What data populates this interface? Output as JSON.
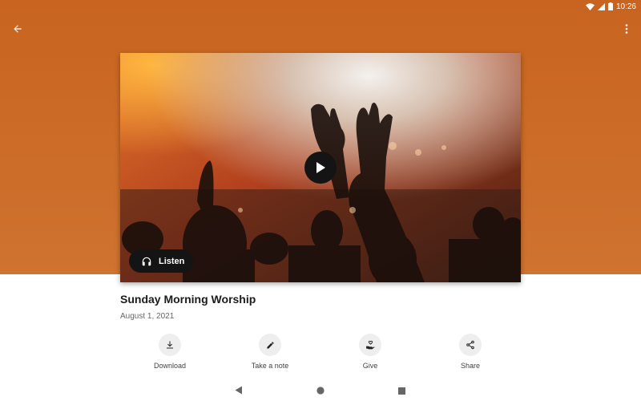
{
  "status_bar": {
    "time": "10:26"
  },
  "media": {
    "listen_label": "Listen"
  },
  "sermon": {
    "title": "Sunday Morning Worship",
    "date": "August 1, 2021"
  },
  "actions": [
    {
      "label": "Download",
      "icon": "download-icon"
    },
    {
      "label": "Take a note",
      "icon": "pencil-icon"
    },
    {
      "label": "Give",
      "icon": "give-hand-icon"
    },
    {
      "label": "Share",
      "icon": "share-icon"
    }
  ],
  "colors": {
    "header": "#cc6d29",
    "button_dark": "#141414",
    "action_circle": "#eeeeee"
  }
}
